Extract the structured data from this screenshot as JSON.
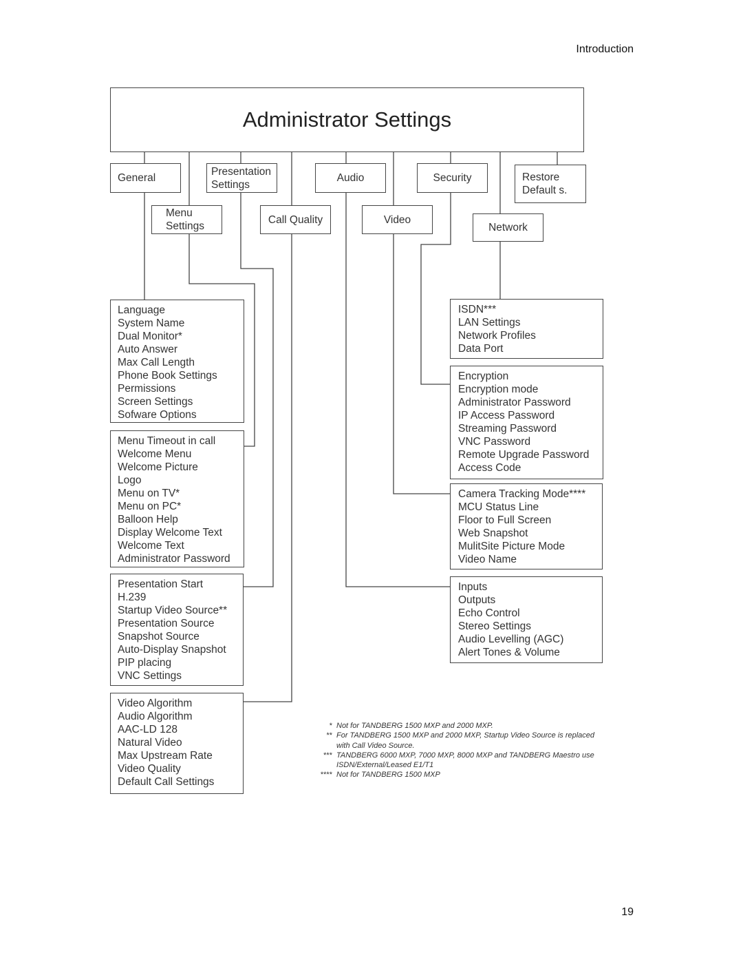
{
  "header": {
    "section": "Introduction"
  },
  "page_number": "19",
  "title": "Administrator Settings",
  "categories": {
    "general": "General",
    "presentation": "Presentation Settings",
    "audio": "Audio",
    "security": "Security",
    "restore": "Restore Default s.",
    "menu": "Menu Settings",
    "call_quality": "Call Quality",
    "video": "Video",
    "network": "Network"
  },
  "lists": {
    "general": [
      "Language",
      "System Name",
      "Dual Monitor*",
      "Auto Answer",
      "Max Call Length",
      "Phone Book Settings",
      "Permissions",
      "Screen Settings",
      "Sofware Options"
    ],
    "menu": [
      "Menu Timeout in call",
      "Welcome Menu",
      "Welcome Picture",
      "Logo",
      "Menu on TV*",
      "Menu on PC*",
      "Balloon Help",
      "Display Welcome Text",
      "Welcome Text",
      "Administrator Password"
    ],
    "presentation": [
      "Presentation Start",
      "H.239",
      "Startup Video Source**",
      "Presentation Source",
      "Snapshot Source",
      "Auto-Display Snapshot",
      "PIP placing",
      "VNC Settings"
    ],
    "call_quality": [
      "Video Algorithm",
      "Audio Algorithm",
      "AAC-LD 128",
      "Natural Video",
      "Max Upstream Rate",
      "Video Quality",
      "Default Call Settings"
    ],
    "network": [
      "ISDN***",
      "LAN Settings",
      "Network Profiles",
      "Data Port"
    ],
    "security": [
      "Encryption",
      "Encryption mode",
      "Administrator Password",
      "IP Access Password",
      "Streaming Password",
      "VNC Password",
      "Remote Upgrade Password",
      "Access Code"
    ],
    "video": [
      "Camera Tracking Mode****",
      "MCU Status Line",
      "Floor to Full Screen",
      "Web Snapshot",
      "MulitSite Picture Mode",
      "Video Name"
    ],
    "audio": [
      "Inputs",
      "Outputs",
      "Echo Control",
      "Stereo Settings",
      "Audio Levelling (AGC)",
      "Alert Tones & Volume"
    ]
  },
  "footnotes": [
    {
      "mark": "*",
      "text": "Not for TANDBERG 1500 MXP and 2000 MXP."
    },
    {
      "mark": "**",
      "text": "For TANDBERG 1500 MXP and 2000 MXP, Startup Video Source is replaced with Call Video Source."
    },
    {
      "mark": "***",
      "text": "TANDBERG 6000 MXP, 7000 MXP, 8000 MXP and TANDBERG Maestro use ISDN/External/Leased E1/T1"
    },
    {
      "mark": "****",
      "text": "Not for TANDBERG 1500 MXP"
    }
  ]
}
